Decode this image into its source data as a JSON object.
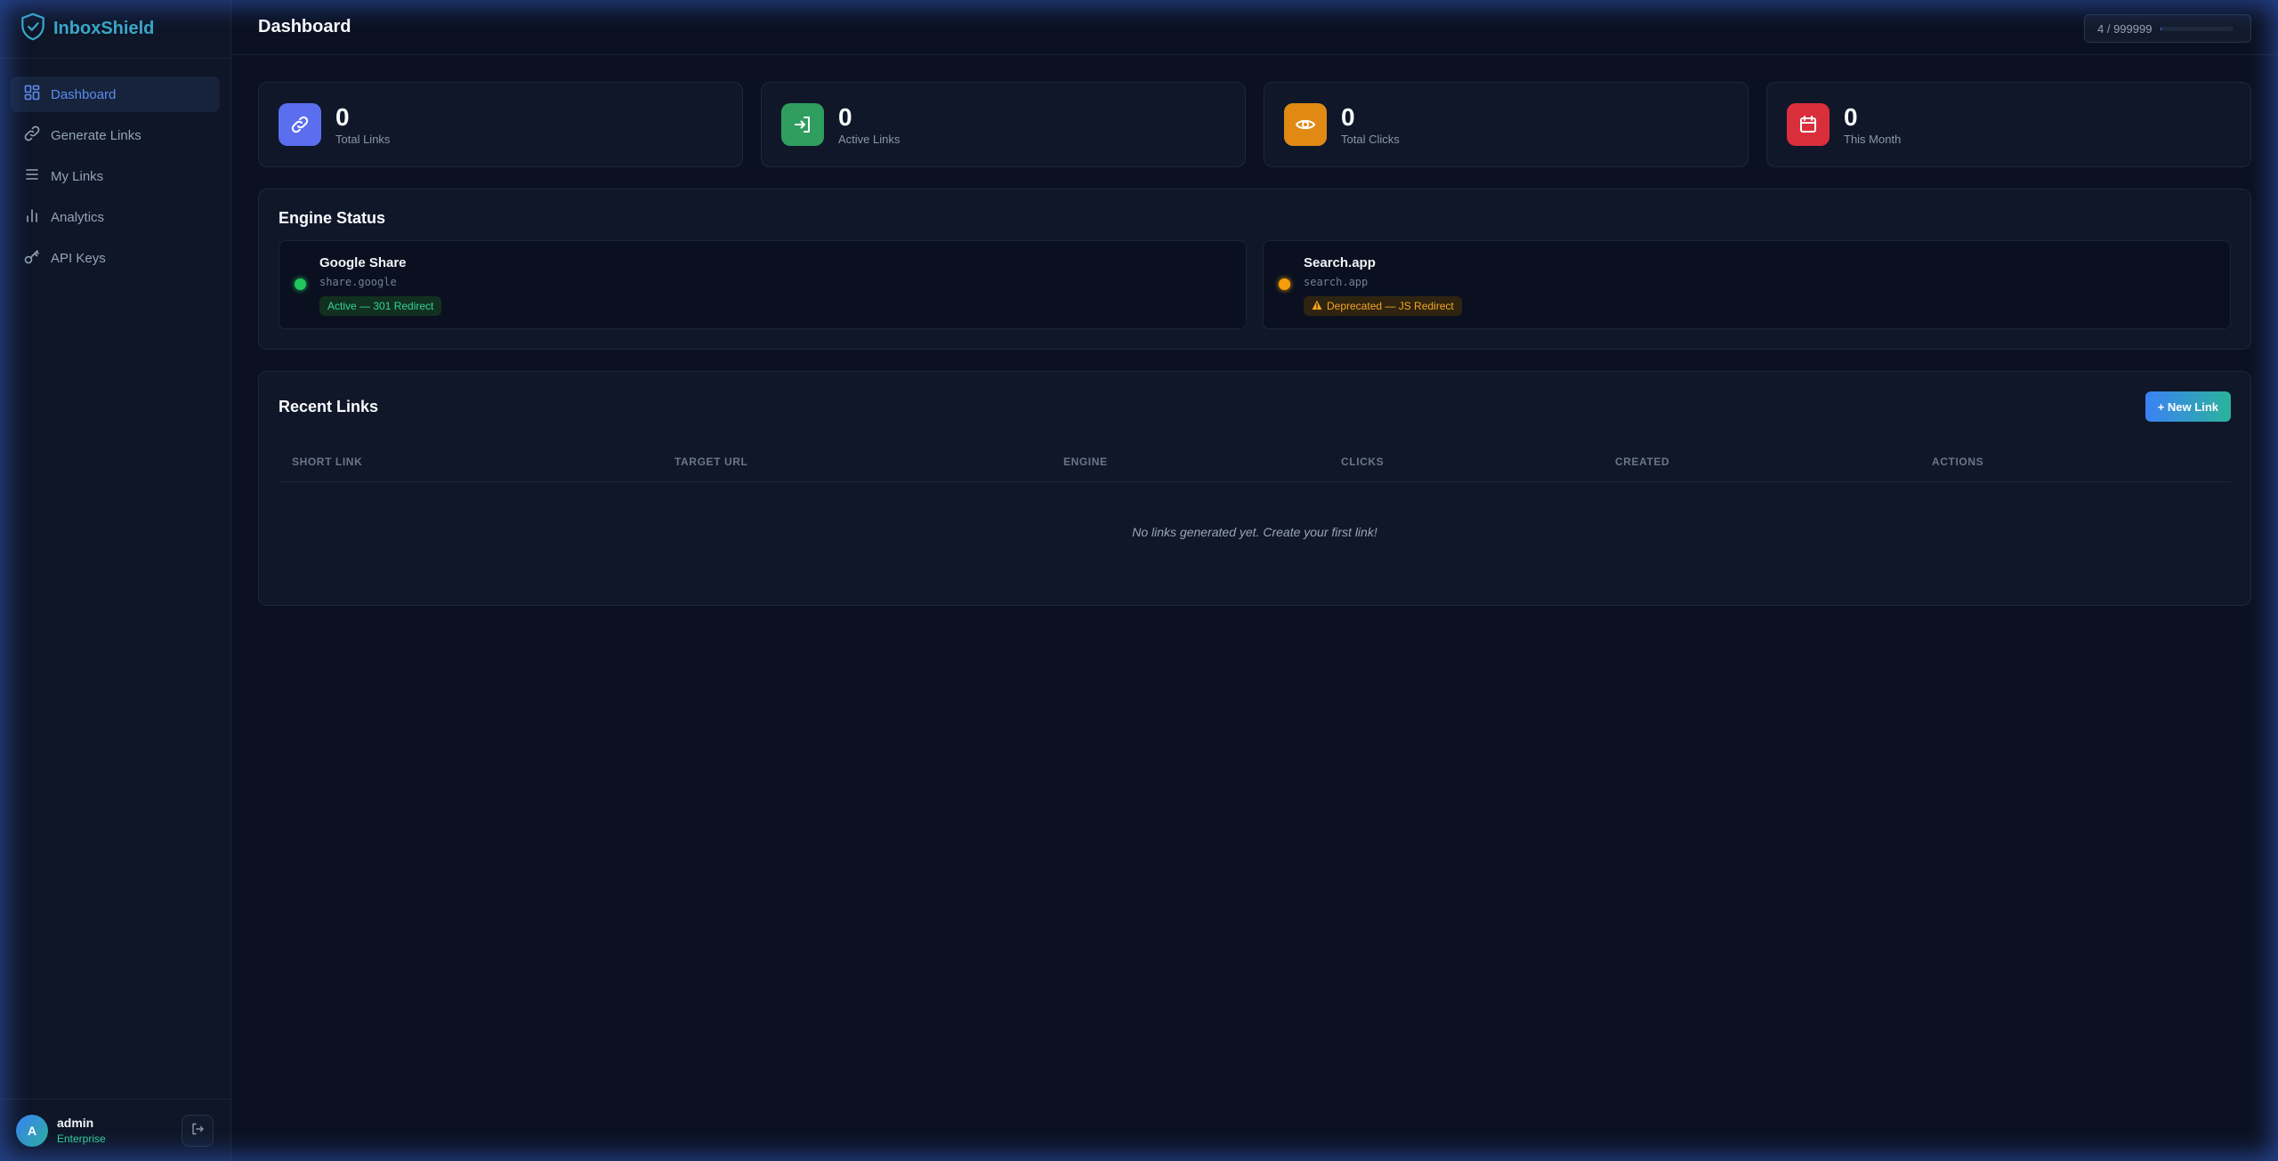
{
  "app": {
    "name": "InboxShield"
  },
  "sidebar": {
    "items": [
      {
        "label": "Dashboard",
        "icon": "grid-icon",
        "active": true
      },
      {
        "label": "Generate Links",
        "icon": "link-icon"
      },
      {
        "label": "My Links",
        "icon": "list-icon"
      },
      {
        "label": "Analytics",
        "icon": "bar-chart-icon"
      },
      {
        "label": "API Keys",
        "icon": "key-icon"
      }
    ]
  },
  "user": {
    "initial": "A",
    "name": "admin",
    "plan": "Enterprise"
  },
  "header": {
    "title": "Dashboard",
    "quota": "4 / 999999",
    "quota_used": 4,
    "quota_total": 999999
  },
  "stats": [
    {
      "value": "0",
      "label": "Total Links",
      "icon": "link-icon",
      "color": "#5b6ef0"
    },
    {
      "value": "0",
      "label": "Active Links",
      "icon": "login-arrow-icon",
      "color": "#2f9e5f"
    },
    {
      "value": "0",
      "label": "Total Clicks",
      "icon": "eye-icon",
      "color": "#e08a14"
    },
    {
      "value": "0",
      "label": "This Month",
      "icon": "calendar-icon",
      "color": "#d92f3c"
    }
  ],
  "engine_status": {
    "title": "Engine Status",
    "engines": [
      {
        "name": "Google Share",
        "domain": "share.google",
        "badge": "Active — 301 Redirect",
        "status": "active",
        "color": "#22c55e"
      },
      {
        "name": "Search.app",
        "domain": "search.app",
        "badge": "Deprecated — JS Redirect",
        "status": "deprecated",
        "color": "#f59e0b"
      }
    ]
  },
  "recent_links": {
    "title": "Recent Links",
    "new_button": "+ New Link",
    "columns": [
      "SHORT LINK",
      "TARGET URL",
      "ENGINE",
      "CLICKS",
      "CREATED",
      "ACTIONS"
    ],
    "empty_message": "No links generated yet. Create your first link!"
  }
}
